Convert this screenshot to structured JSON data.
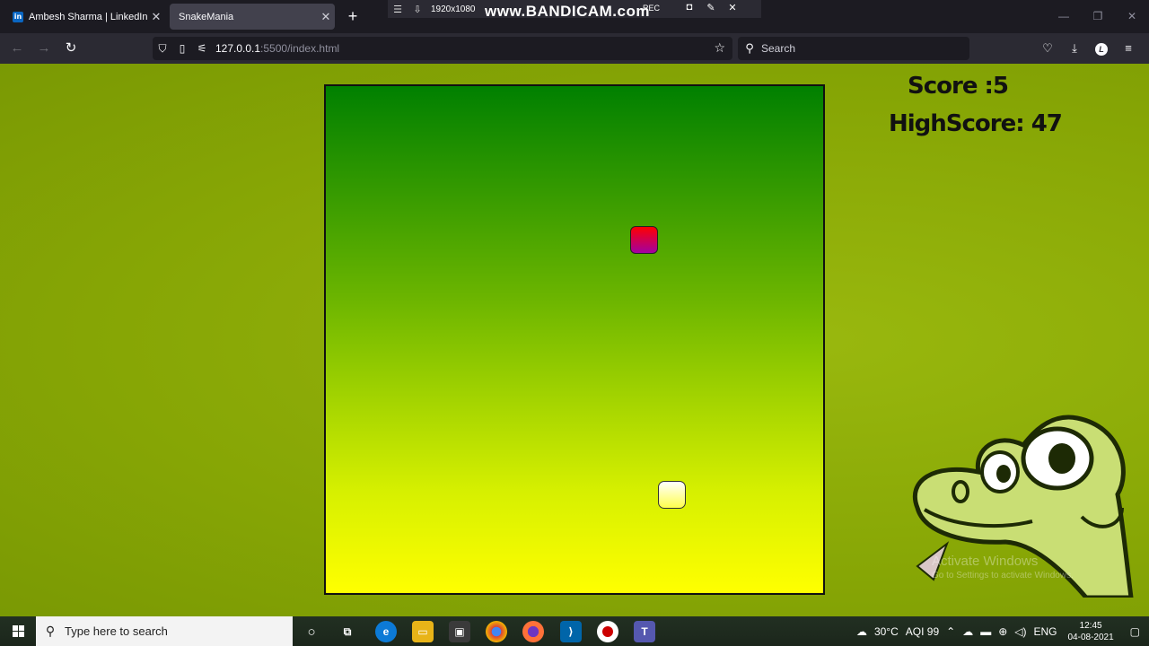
{
  "browser": {
    "tabs": [
      {
        "title": "Ambesh Sharma | LinkedIn",
        "favicon": "in",
        "active": false
      },
      {
        "title": "SnakeMania",
        "active": true
      }
    ],
    "url_host": "127.0.0.1",
    "url_path": ":5500/index.html",
    "search_placeholder": "Search",
    "profile_initial": "L"
  },
  "recorder": {
    "resolution": "1920x1080",
    "brand": "www.BANDICAM.com",
    "rec_label": "REC"
  },
  "game": {
    "score_text": "Score :5",
    "highscore_text": "HighScore: 47",
    "colors": {
      "background": "#8aa905",
      "board_top": "#008000",
      "board_bottom": "#ffff00",
      "food": "#e00020",
      "snake_head": "#ffff66"
    }
  },
  "watermark": {
    "line1": "Activate Windows",
    "line2": "Go to Settings to activate Windows."
  },
  "taskbar": {
    "search_placeholder": "Type here to search",
    "weather": "30°C",
    "aqi": "AQI 99",
    "language": "ENG",
    "time": "12:45",
    "date": "04-08-2021"
  }
}
